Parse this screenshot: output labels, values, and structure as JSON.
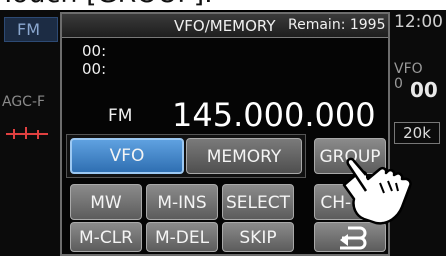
{
  "caption": "Touch [GROUP].",
  "side": {
    "mode_tab": "FM",
    "agc_label": "AGC-F",
    "time": "12:00",
    "vfo_label": "VFO",
    "vfo_digit_prefix": "0",
    "big_digits": "00",
    "step_tag": "20k"
  },
  "window": {
    "title": "VFO/MEMORY",
    "remain": "Remain: 1995",
    "ch_line1": "00:",
    "ch_line2": "00:",
    "mode": "FM",
    "frequency": "145.000.000"
  },
  "buttons": {
    "vfo": "VFO",
    "memory": "MEMORY",
    "group": "GROUP",
    "mw": "MW",
    "m_ins": "M-INS",
    "select": "SELECT",
    "ch_ins": "CH-INS",
    "m_clr": "M-CLR",
    "m_del": "M-DEL",
    "skip": "SKIP",
    "return_icon": "return-arrow-icon"
  },
  "colors": {
    "screen_bg": "#000000",
    "vfo_active": "#3f86cc",
    "button_gray": "#747474"
  }
}
